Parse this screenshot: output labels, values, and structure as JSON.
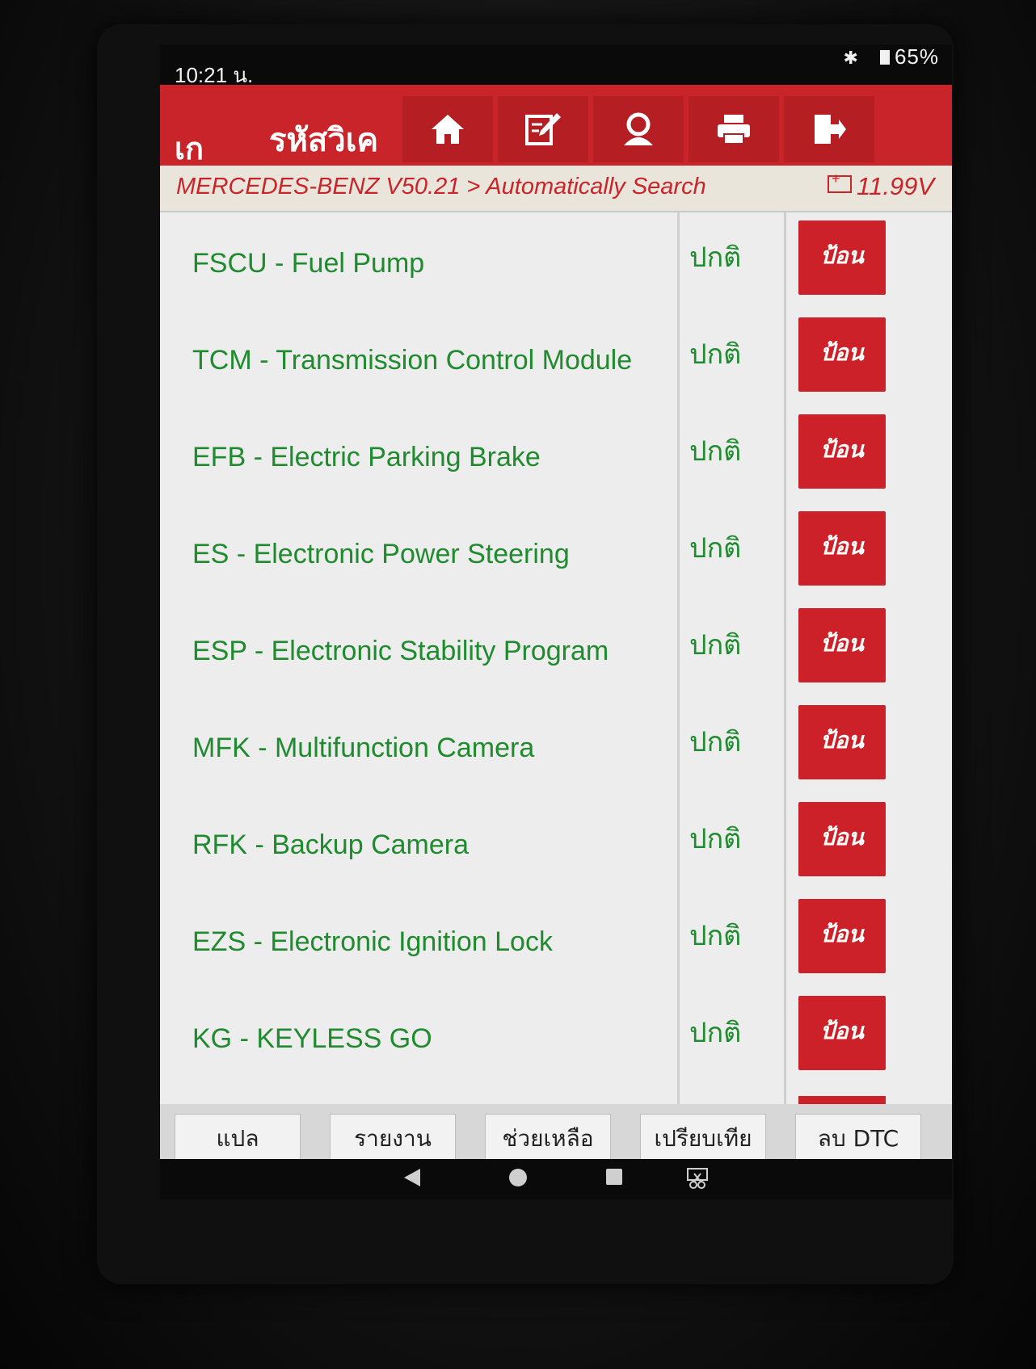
{
  "status_bar": {
    "time": "10:21 น.",
    "battery": "65%"
  },
  "toolbar": {
    "back_label": "เก",
    "title": "รหัสวิเค",
    "buttons": [
      "home-icon",
      "edit-icon",
      "profile-icon",
      "print-icon",
      "exit-icon"
    ]
  },
  "breadcrumb": {
    "path": "MERCEDES-BENZ V50.21 > Automatically Search",
    "voltage": "11.99V"
  },
  "modules": [
    {
      "name": "FSCU - Fuel Pump",
      "status": "ปกติ",
      "button": "ป้อน"
    },
    {
      "name": "TCM - Transmission Control Module",
      "status": "ปกติ",
      "button": "ป้อน"
    },
    {
      "name": "EFB - Electric Parking Brake",
      "status": "ปกติ",
      "button": "ป้อน"
    },
    {
      "name": "ES - Electronic Power Steering",
      "status": "ปกติ",
      "button": "ป้อน"
    },
    {
      "name": "ESP - Electronic Stability Program",
      "status": "ปกติ",
      "button": "ป้อน"
    },
    {
      "name": "MFK - Multifunction Camera",
      "status": "ปกติ",
      "button": "ป้อน"
    },
    {
      "name": "RFK - Backup Camera",
      "status": "ปกติ",
      "button": "ป้อน"
    },
    {
      "name": "EZS - Electronic Ignition Lock",
      "status": "ปกติ",
      "button": "ป้อน"
    },
    {
      "name": "KG - KEYLESS GO",
      "status": "ปกติ",
      "button": "ป้อน"
    }
  ],
  "bottom_buttons": [
    "แปล",
    "รายงาน",
    "ช่วยเหลือ",
    "เปรียบเทีย",
    "ลบ DTC"
  ],
  "colors": {
    "accent": "#c8242a",
    "module_text": "#1f8a2e"
  }
}
